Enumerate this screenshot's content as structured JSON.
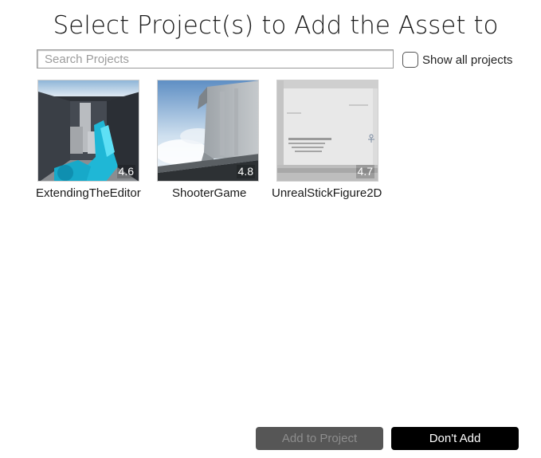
{
  "dialog": {
    "title": "Select Project(s) to Add the Asset to"
  },
  "search": {
    "placeholder": "Search Projects",
    "value": ""
  },
  "show_all": {
    "label": "Show all projects",
    "checked": false
  },
  "projects": [
    {
      "name": "ExtendingTheEditor",
      "version": "4.6"
    },
    {
      "name": "ShooterGame",
      "version": "4.8"
    },
    {
      "name": "UnrealStickFigure2D",
      "version": "4.7"
    }
  ],
  "buttons": {
    "add_to_project": "Add to Project",
    "dont_add": "Don't Add"
  }
}
